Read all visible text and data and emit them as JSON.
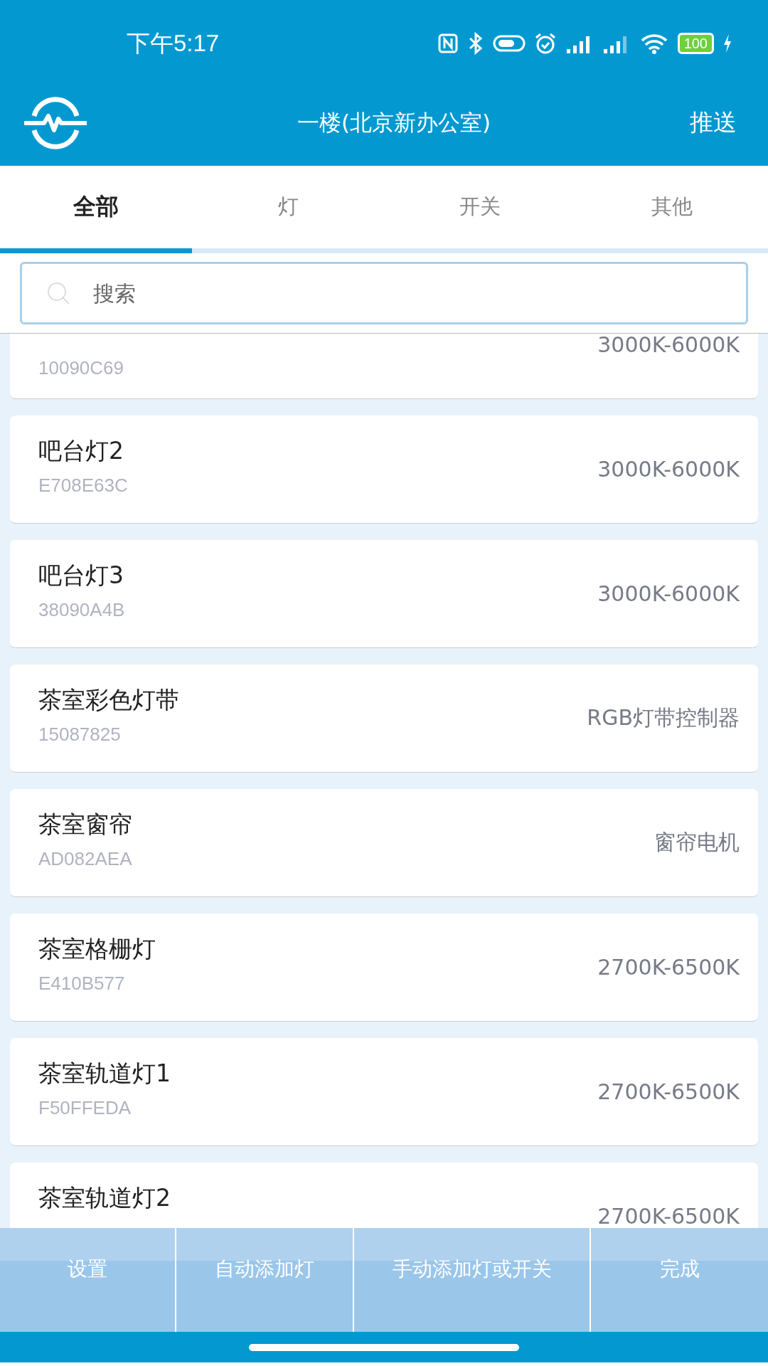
{
  "status_bar": {
    "time": "下午5:17",
    "battery": "100"
  },
  "header": {
    "title": "一楼(北京新办公室)",
    "action": "推送"
  },
  "tabs": [
    {
      "label": "全部",
      "selected": true
    },
    {
      "label": "灯",
      "selected": false
    },
    {
      "label": "开关",
      "selected": false
    },
    {
      "label": "其他",
      "selected": false
    }
  ],
  "search": {
    "placeholder": "搜索"
  },
  "devices": [
    {
      "id": "10090C69",
      "spec": "3000K-6000K"
    },
    {
      "name": "吧台灯2",
      "id": "E708E63C",
      "spec": "3000K-6000K"
    },
    {
      "name": "吧台灯3",
      "id": "38090A4B",
      "spec": "3000K-6000K"
    },
    {
      "name": "茶室彩色灯带",
      "id": "15087825",
      "spec": "RGB灯带控制器"
    },
    {
      "name": "茶室窗帘",
      "id": "AD082AEA",
      "spec": "窗帘电机"
    },
    {
      "name": "茶室格栅灯",
      "id": "E410B577",
      "spec": "2700K-6500K"
    },
    {
      "name": "茶室轨道灯1",
      "id": "F50FFEDA",
      "spec": "2700K-6500K"
    },
    {
      "name": "茶室轨道灯2",
      "spec": "2700K-6500K"
    }
  ],
  "bottom_buttons": [
    "设置",
    "自动添加灯",
    "手动添加灯或开关",
    "完成"
  ]
}
